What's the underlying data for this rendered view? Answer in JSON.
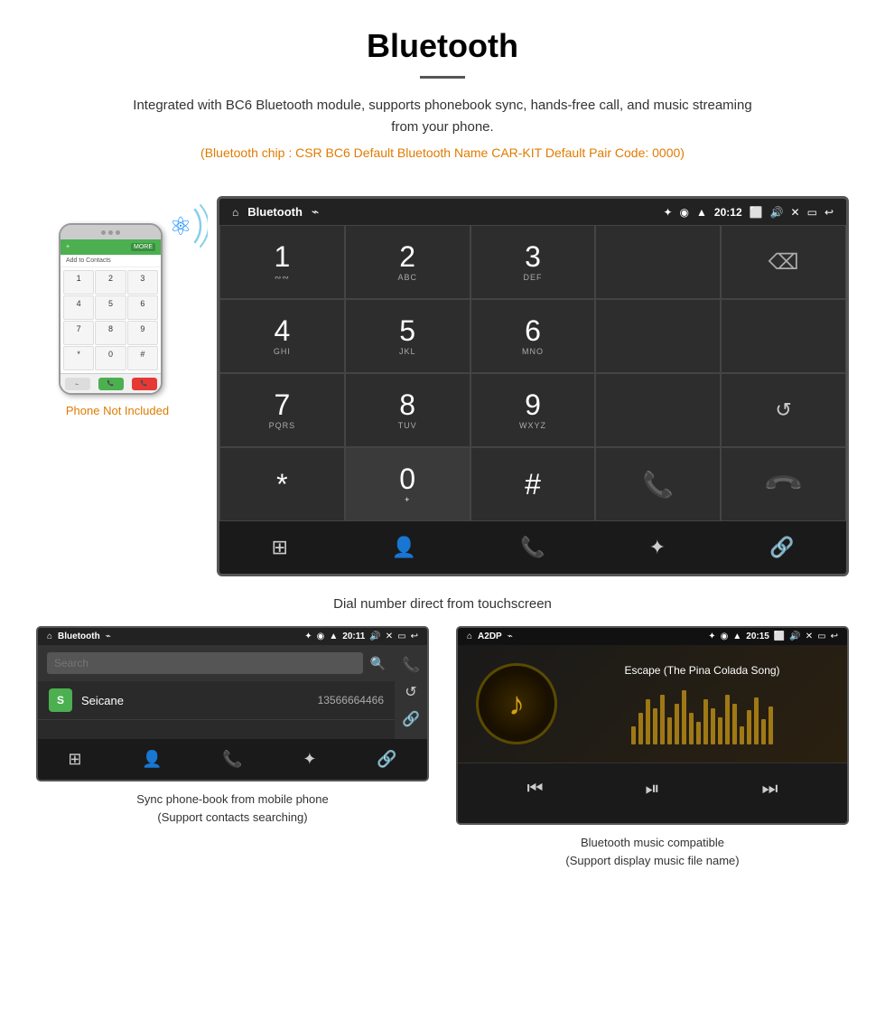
{
  "header": {
    "title": "Bluetooth",
    "description": "Integrated with BC6 Bluetooth module, supports phonebook sync, hands-free call, and music streaming from your phone.",
    "specs": "(Bluetooth chip : CSR BC6    Default Bluetooth Name CAR-KIT    Default Pair Code: 0000)"
  },
  "phone_label": "Phone Not Included",
  "car_screen": {
    "status_bar": {
      "home_icon": "⌂",
      "title": "Bluetooth",
      "usb_icon": "⌁",
      "bt_icon": "✦",
      "location_icon": "◉",
      "signal_icon": "▲",
      "time": "20:12",
      "camera_icon": "📷",
      "volume_icon": "🔊",
      "x_icon": "✕",
      "window_icon": "▭",
      "back_icon": "↩"
    },
    "dial_keys": [
      {
        "num": "1",
        "letters": "∾∾"
      },
      {
        "num": "2",
        "letters": "ABC"
      },
      {
        "num": "3",
        "letters": "DEF"
      },
      {
        "num": "",
        "letters": "",
        "type": "empty"
      },
      {
        "num": "⌫",
        "letters": "",
        "type": "backspace"
      },
      {
        "num": "4",
        "letters": "GHI"
      },
      {
        "num": "5",
        "letters": "JKL"
      },
      {
        "num": "6",
        "letters": "MNO"
      },
      {
        "num": "",
        "letters": "",
        "type": "empty"
      },
      {
        "num": "",
        "letters": "",
        "type": "empty"
      },
      {
        "num": "7",
        "letters": "PQRS"
      },
      {
        "num": "8",
        "letters": "TUV"
      },
      {
        "num": "9",
        "letters": "WXYZ"
      },
      {
        "num": "",
        "letters": "",
        "type": "empty"
      },
      {
        "num": "↺",
        "letters": "",
        "type": "refresh"
      },
      {
        "num": "*",
        "letters": ""
      },
      {
        "num": "0",
        "letters": "+"
      },
      {
        "num": "#",
        "letters": ""
      },
      {
        "num": "📞",
        "letters": "",
        "type": "call-green"
      },
      {
        "num": "📞",
        "letters": "",
        "type": "call-red"
      }
    ],
    "bottom_nav": [
      "⊞",
      "👤",
      "📞",
      "✦",
      "🔗"
    ]
  },
  "main_caption": "Dial number direct from touchscreen",
  "phonebook_screen": {
    "title": "Bluetooth",
    "status_time": "20:11",
    "search_placeholder": "Search",
    "contacts": [
      {
        "initial": "S",
        "name": "Seicane",
        "phone": "13566664466"
      }
    ],
    "bottom_nav": [
      "⊞",
      "👤",
      "📞",
      "✦",
      "🔗"
    ],
    "side_icons": [
      "📞",
      "↺",
      "🔗"
    ]
  },
  "a2dp_screen": {
    "title": "A2DP",
    "status_time": "20:15",
    "song_title": "Escape (The Pina Colada Song)",
    "controls": [
      "⏮",
      "⏯",
      "⏭"
    ]
  },
  "bottom_captions": [
    "Sync phone-book from mobile phone\n(Support contacts searching)",
    "Bluetooth music compatible\n(Support display music file name)"
  ],
  "eq_heights": [
    20,
    35,
    50,
    40,
    55,
    30,
    45,
    60,
    35,
    25,
    50,
    40,
    30,
    55,
    45,
    20,
    38,
    52,
    28,
    42
  ]
}
